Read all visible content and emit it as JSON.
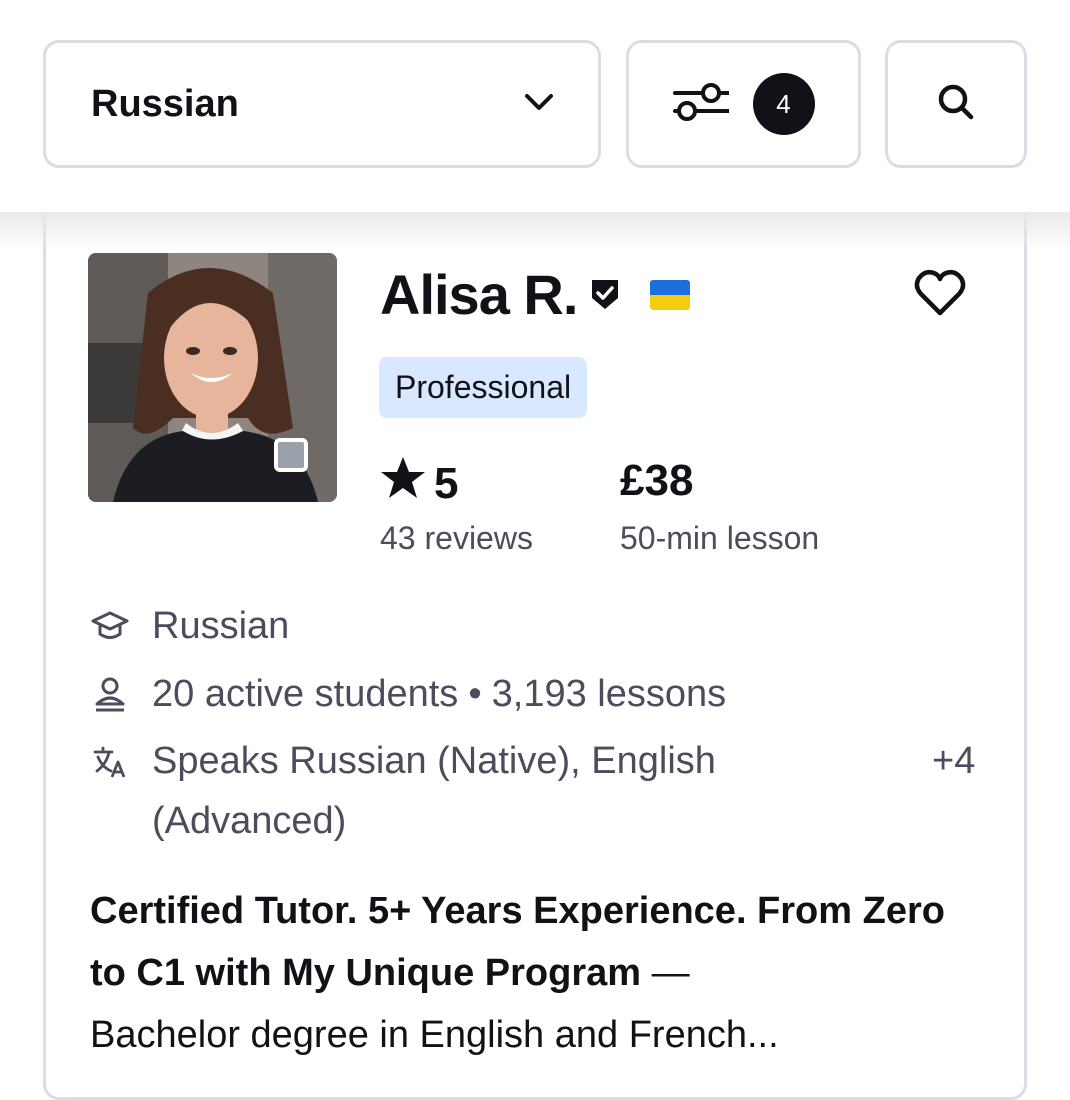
{
  "filters": {
    "language": "Russian",
    "filter_count": "4"
  },
  "tutor": {
    "name": "Alisa R.",
    "badge": "Professional",
    "rating": "5",
    "reviews": "43 reviews",
    "price": "£38",
    "lesson_length": "50-min lesson",
    "subject": "Russian",
    "students": "20 active students",
    "separator": "•",
    "lessons": "3,193 lessons",
    "speaks_line1": "Speaks Russian (Native), English",
    "speaks_line2": "(Advanced)",
    "more_languages": "+4",
    "headline_bold": "Certified Tutor. 5+ Years Experience. From Zero to C1 with My Unique Program",
    "headline_dash": " — ",
    "headline_text": "Bachelor degree in English and French..."
  },
  "colors": {
    "badge_bg": "#d8e8ff",
    "flag_blue": "#1d6fdc",
    "flag_yellow": "#f5cc0f",
    "text_primary": "#121117",
    "text_secondary": "#4d4c5c"
  },
  "icons": {
    "dropdown": "chevron-down-icon",
    "filter": "sliders-icon",
    "search": "search-icon",
    "verified": "verified-shield-icon",
    "favorite": "heart-icon",
    "rating": "star-icon",
    "subject": "graduation-cap-icon",
    "students": "person-icon",
    "languages": "translate-icon"
  }
}
